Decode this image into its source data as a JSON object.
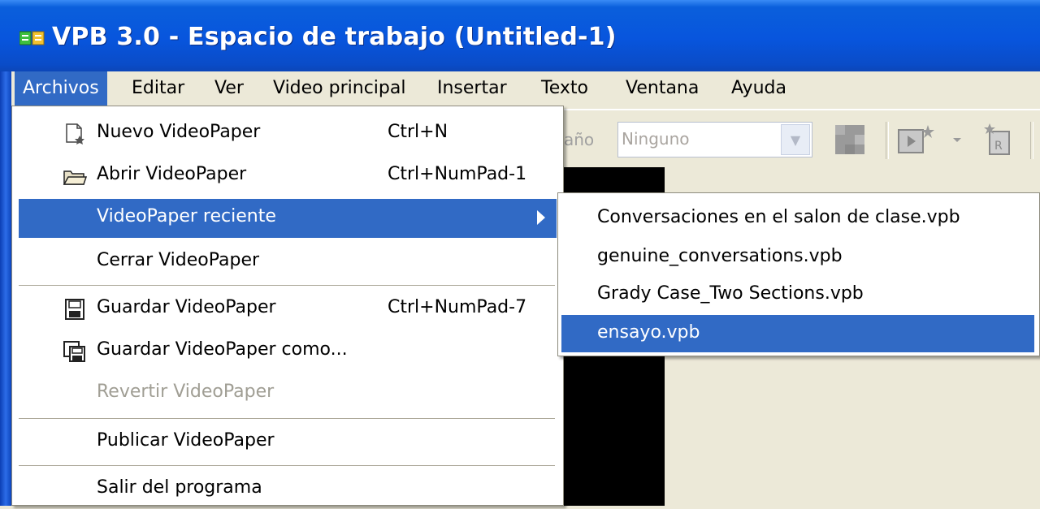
{
  "window": {
    "title": "VPB 3.0 - Espacio de trabajo (Untitled-1)"
  },
  "menubar": [
    {
      "label": "Archivos",
      "active": true
    },
    {
      "label": "Editar"
    },
    {
      "label": "Ver"
    },
    {
      "label": "Video principal"
    },
    {
      "label": "Insertar"
    },
    {
      "label": "Texto"
    },
    {
      "label": "Ventana"
    },
    {
      "label": "Ayuda"
    }
  ],
  "toolbar": {
    "size_label": "año",
    "size_value": "Ninguno"
  },
  "file_menu": {
    "items": [
      {
        "label": "Nuevo VideoPaper",
        "shortcut": "Ctrl+N",
        "icon": "new-document-icon"
      },
      {
        "label": "Abrir VideoPaper",
        "shortcut": "Ctrl+NumPad-1",
        "icon": "open-folder-icon"
      },
      {
        "label": "VideoPaper reciente",
        "shortcut": "",
        "submenu": true,
        "highlighted": true
      },
      {
        "label": "Cerrar VideoPaper",
        "shortcut": ""
      },
      {
        "label": "Guardar VideoPaper",
        "shortcut": "Ctrl+NumPad-7",
        "icon": "floppy-disk-icon"
      },
      {
        "label": "Guardar VideoPaper como...",
        "shortcut": "",
        "icon": "save-as-icon"
      },
      {
        "label": "Revertir VideoPaper",
        "shortcut": "",
        "disabled": true
      },
      {
        "label": "Publicar VideoPaper",
        "shortcut": ""
      },
      {
        "label": "Salir del programa",
        "shortcut": ""
      }
    ]
  },
  "recent_submenu": {
    "items": [
      {
        "label": "Conversaciones en el salon de clase.vpb"
      },
      {
        "label": "genuine_conversations.vpb"
      },
      {
        "label": "Grady Case_Two Sections.vpb"
      },
      {
        "label": "ensayo.vpb",
        "highlighted": true
      }
    ]
  },
  "colors": {
    "selection": "#316ac5",
    "titlebar": "#0855dd",
    "face": "#ece9d8"
  }
}
